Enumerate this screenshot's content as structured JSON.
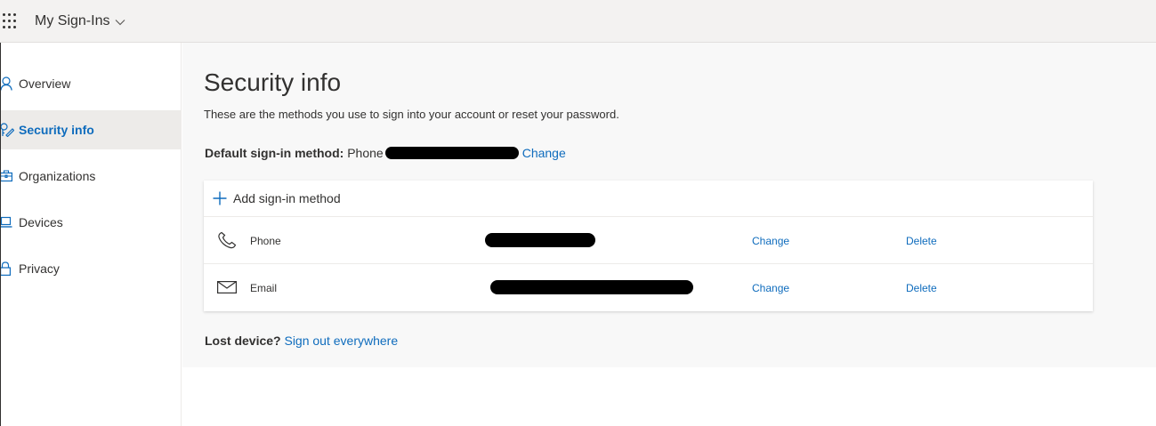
{
  "header": {
    "app_title": "My Sign-Ins"
  },
  "sidebar": {
    "items": [
      {
        "label": "Overview",
        "icon": "person-icon",
        "active": false
      },
      {
        "label": "Security info",
        "icon": "security-key-icon",
        "active": true
      },
      {
        "label": "Organizations",
        "icon": "briefcase-icon",
        "active": false
      },
      {
        "label": "Devices",
        "icon": "laptop-icon",
        "active": false
      },
      {
        "label": "Privacy",
        "icon": "lock-icon",
        "active": false
      }
    ]
  },
  "main": {
    "title": "Security info",
    "description": "These are the methods you use to sign into your account or reset your password.",
    "default_method": {
      "label": "Default sign-in method:",
      "value": "Phone",
      "change_link": "Change"
    },
    "add_method_label": "Add sign-in method",
    "methods": [
      {
        "name": "Phone",
        "icon": "phone-icon",
        "change": "Change",
        "delete": "Delete"
      },
      {
        "name": "Email",
        "icon": "mail-icon",
        "change": "Change",
        "delete": "Delete"
      }
    ],
    "lost_device": {
      "label": "Lost device?",
      "link": "Sign out everywhere"
    }
  },
  "colors": {
    "accent": "#0f6cbd",
    "header_bg": "#f3f2f1",
    "content_bg": "#f8f8f8",
    "active_nav_bg": "#edebe9"
  }
}
